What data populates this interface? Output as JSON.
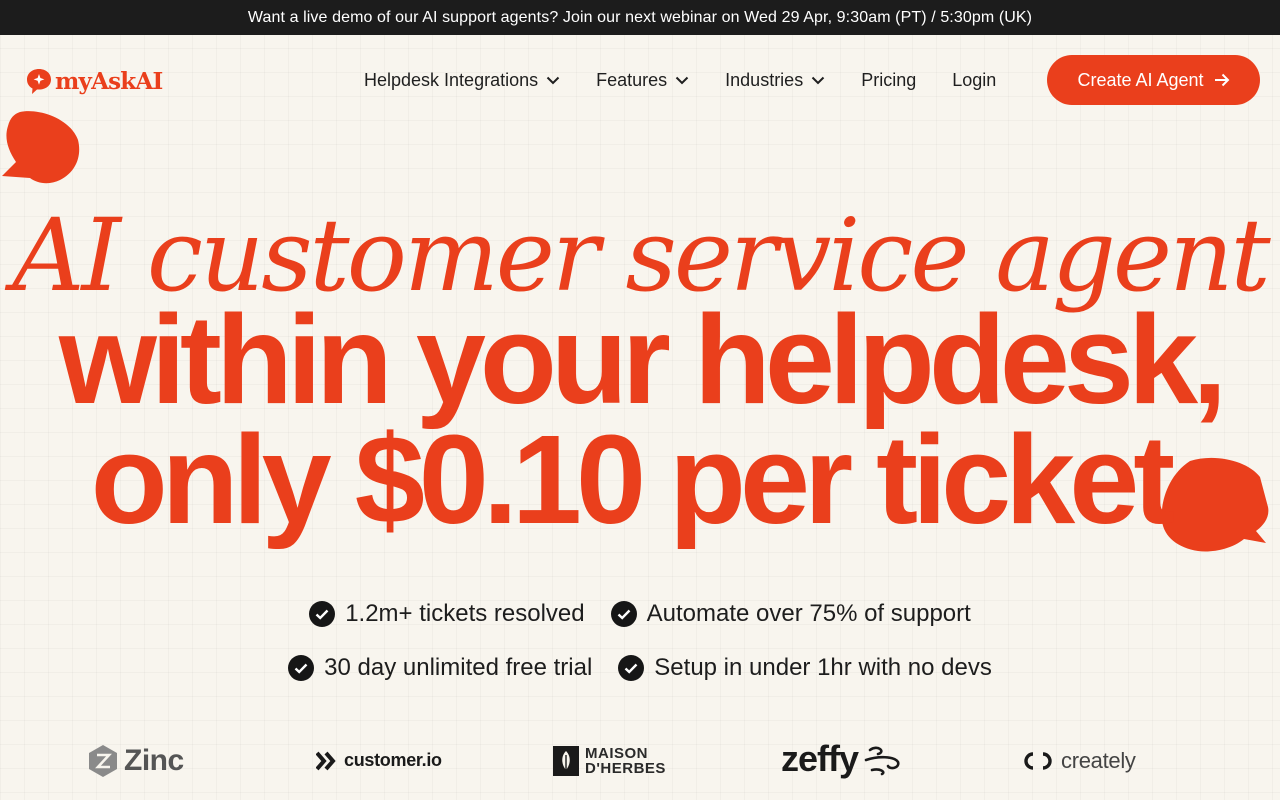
{
  "announcement": "Want a live demo of our AI support agents? Join our next webinar on Wed 29 Apr, 9:30am (PT) / 5:30pm (UK)",
  "logo": {
    "text": "myAskAI"
  },
  "nav": {
    "helpdesk_integrations": "Helpdesk Integrations",
    "features": "Features",
    "industries": "Industries",
    "pricing": "Pricing",
    "login": "Login"
  },
  "cta": {
    "label": "Create AI Agent"
  },
  "hero": {
    "line1": "AI customer service agent",
    "line2": "within your helpdesk,",
    "line3": "only $0.10 per ticket"
  },
  "bullets": {
    "b1": "1.2m+ tickets resolved",
    "b2": "Automate over 75% of support",
    "b3": "30 day unlimited free trial",
    "b4": "Setup in under 1hr with no devs"
  },
  "brands": {
    "zinc": "Zinc",
    "customerio": "customer.io",
    "maison_1": "MAISON",
    "maison_2": "D'HERBES",
    "zeffy": "zeffy",
    "creately": "creately"
  },
  "colors": {
    "brand": "#ea3f1c",
    "background": "#f8f5ee",
    "announce_bg": "#1c1c1c"
  },
  "icons": [
    "chevron-down-icon",
    "arrow-right-icon",
    "check-circle-icon",
    "speech-bubble-icon"
  ]
}
